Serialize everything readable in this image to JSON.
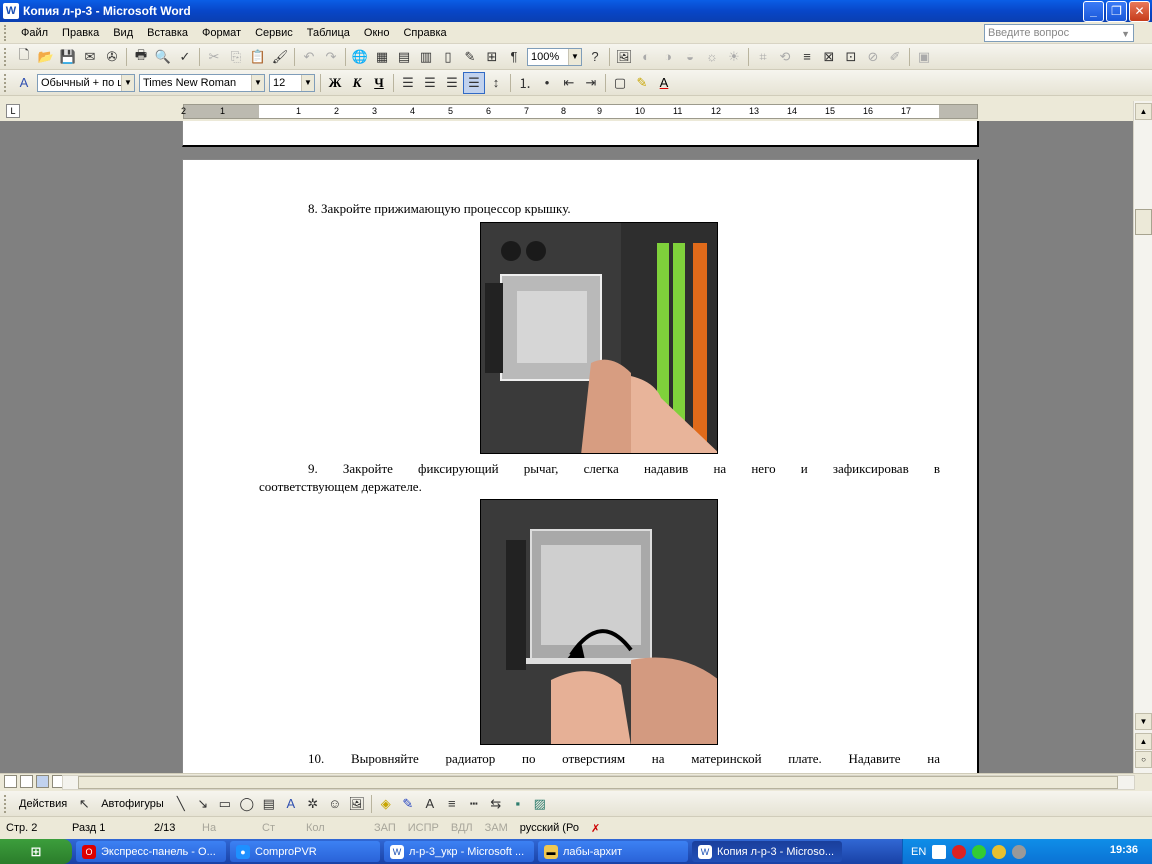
{
  "window": {
    "title": "Копия л-р-3 - Microsoft Word",
    "app_icon": "word-icon"
  },
  "menu": {
    "items": [
      "Файл",
      "Правка",
      "Вид",
      "Вставка",
      "Формат",
      "Сервис",
      "Таблица",
      "Окно",
      "Справка"
    ],
    "help_placeholder": "Введите вопрос"
  },
  "standard_toolbar": {
    "zoom": "100%"
  },
  "formatting_toolbar": {
    "style": "Обычный + по ц",
    "font": "Times New Roman",
    "size": "12",
    "bold": "Ж",
    "italic": "К",
    "underline": "Ч"
  },
  "ruler": {
    "ticks": [
      "2",
      "1",
      "1",
      "2",
      "3",
      "4",
      "5",
      "6",
      "7",
      "8",
      "9",
      "10",
      "11",
      "12",
      "13",
      "14",
      "15",
      "16",
      "17"
    ]
  },
  "document": {
    "step8": "8. Закройте прижимающую процессор крышку.",
    "step9_line1": "9. Закройте фиксирующий рычаг, слегка надавив на него и зафиксировав в",
    "step9_line2": "соответствующем держателе.",
    "step10_line1": "10. Выровняйте радиатор по отверстиям на материнской плате. Надавите на"
  },
  "drawing_toolbar": {
    "actions": "Действия",
    "autoshapes": "Автофигуры"
  },
  "status": {
    "page": "Стр. 2",
    "section": "Разд 1",
    "pages": "2/13",
    "at": "На",
    "line": "Ст",
    "col": "Кол",
    "rec": "ЗАП",
    "trk": "ИСПР",
    "ext": "ВДЛ",
    "ovr": "ЗАМ",
    "lang": "русский (Ро"
  },
  "taskbar": {
    "start": "пуск",
    "tasks": [
      "Экспресс-панель - О...",
      "ComproPVR",
      "л-р-3_укр - Microsoft ...",
      "лабы-архит",
      "Копия л-р-3 - Microso..."
    ],
    "lang": "EN",
    "clock": "19:36"
  },
  "colors": {
    "titlebar": "#0a5ee6",
    "taskbar": "#1941a5",
    "start": "#3c9e3c"
  }
}
